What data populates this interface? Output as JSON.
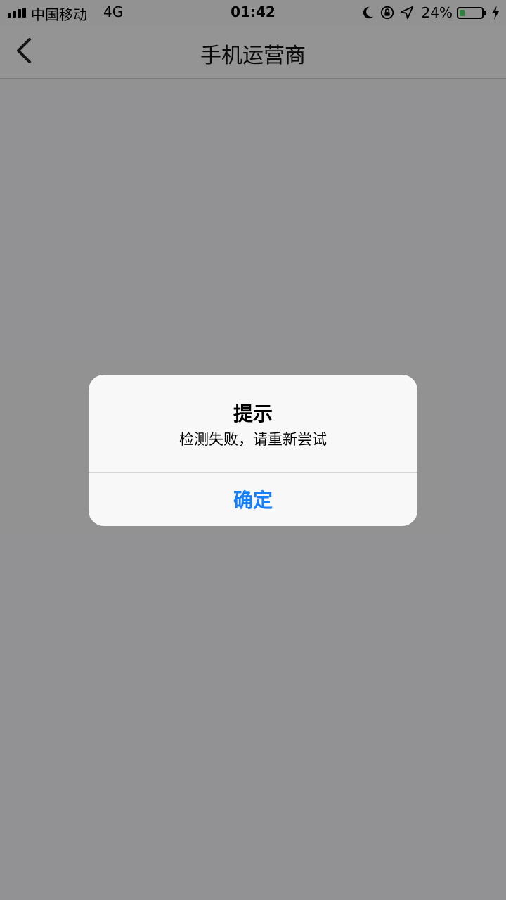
{
  "status_bar": {
    "carrier": "中国移动",
    "network": "4G",
    "time": "01:42",
    "battery_percent_text": "24%",
    "battery_level": 0.24,
    "battery_color": "#4cd964",
    "icons": [
      "signal-icon",
      "moon-icon",
      "orientation-lock-icon",
      "location-icon",
      "battery-icon",
      "charging-icon"
    ]
  },
  "nav": {
    "title": "手机运营商",
    "back_icon": "chevron-left-icon"
  },
  "alert": {
    "title": "提示",
    "message": "检测失败，请重新尝试",
    "button_label": "确定",
    "button_color": "#157efb"
  }
}
